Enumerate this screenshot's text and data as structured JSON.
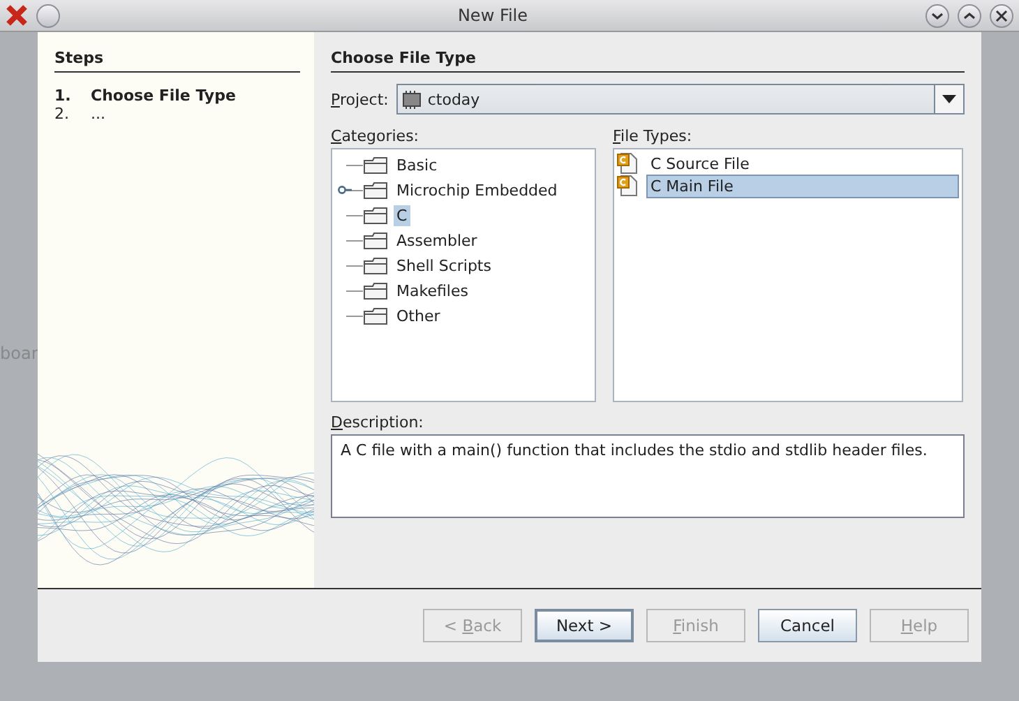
{
  "window": {
    "title": "New File"
  },
  "background_text": "boar",
  "steps": {
    "heading": "Steps",
    "items": [
      {
        "number": "1.",
        "label": "Choose File Type",
        "selected": true
      },
      {
        "number": "2.",
        "label": "...",
        "selected": false
      }
    ]
  },
  "panel": {
    "heading": "Choose File Type",
    "project": {
      "label": {
        "underlined": "P",
        "after": "roject:"
      },
      "value": "ctoday"
    },
    "categories": {
      "label": {
        "underlined": "C",
        "after": "ategories:"
      },
      "items": [
        {
          "label": "Basic",
          "expandable": false,
          "selected": false
        },
        {
          "label": "Microchip Embedded",
          "expandable": true,
          "selected": false
        },
        {
          "label": "C",
          "expandable": false,
          "selected": true
        },
        {
          "label": "Assembler",
          "expandable": false,
          "selected": false
        },
        {
          "label": "Shell Scripts",
          "expandable": false,
          "selected": false
        },
        {
          "label": "Makefiles",
          "expandable": false,
          "selected": false
        },
        {
          "label": "Other",
          "expandable": false,
          "selected": false
        }
      ]
    },
    "file_types": {
      "label": {
        "underlined": "F",
        "after": "ile Types:"
      },
      "items": [
        {
          "label": "C Source File",
          "selected": false
        },
        {
          "label": "C Main File",
          "selected": true
        }
      ]
    },
    "description": {
      "label": {
        "underlined": "D",
        "after": "escription:"
      },
      "text": "A C file with a main() function that includes the stdio and stdlib header files."
    }
  },
  "buttons": [
    {
      "label": {
        "before": "< ",
        "underlined": "B",
        "after": "ack"
      },
      "disabled": true,
      "default": false
    },
    {
      "label": "Next >",
      "disabled": false,
      "default": true
    },
    {
      "label": {
        "underlined": "F",
        "after": "inish"
      },
      "disabled": true,
      "default": false
    },
    {
      "label": "Cancel",
      "disabled": false,
      "default": false
    },
    {
      "label": {
        "underlined": "H",
        "after": "elp"
      },
      "disabled": true,
      "default": false
    }
  ]
}
